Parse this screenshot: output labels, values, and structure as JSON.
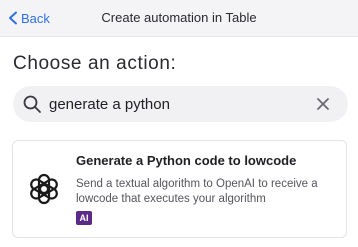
{
  "header": {
    "back_label": "Back",
    "title": "Create automation in Table"
  },
  "main": {
    "heading": "Choose an action:",
    "search": {
      "value": "generate a python",
      "placeholder": ""
    },
    "results": [
      {
        "title": "Generate a Python code to lowcode",
        "description": "Send a textual algorithm to OpenAI to receive a lowcode that executes your algorithm",
        "badge": "AI",
        "icon": "openai-logo-icon"
      }
    ]
  },
  "colors": {
    "accent": "#2f6fe0",
    "badge": "#5b2a86",
    "topbar": "#f4f4f6",
    "search_bg": "#f1f1f4"
  }
}
